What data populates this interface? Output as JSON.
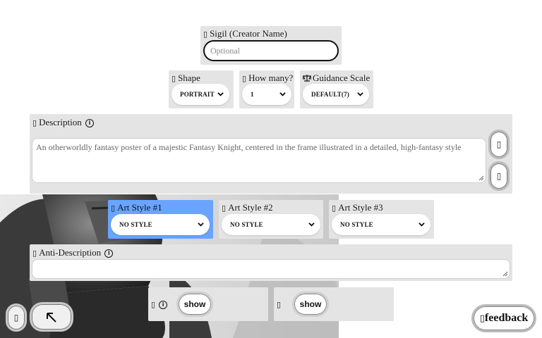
{
  "sigil": {
    "label": "Sigil (Creator Name)",
    "placeholder": "Optional",
    "icon": "glyph-icon"
  },
  "shape": {
    "label": "Shape",
    "value": "PORTRAIT"
  },
  "how_many": {
    "label": "How many?",
    "value": "1"
  },
  "guidance": {
    "label": "Guidance Scale",
    "value": "DEFAULT(7)",
    "icon": "scale-icon"
  },
  "description": {
    "label": "Description",
    "placeholder": "An otherworldly fantasy poster of a majestic Fantasy Knight, centered in the frame illustrated in a detailed, high-fantasy style"
  },
  "art_styles": [
    {
      "label": "Art Style #1",
      "value": "NO STYLE",
      "highlight": "#6aa4ff"
    },
    {
      "label": "Art Style #2",
      "value": "NO STYLE"
    },
    {
      "label": "Art Style #3",
      "value": "NO STYLE"
    }
  ],
  "anti_description": {
    "label": "Anti-Description",
    "placeholder": ""
  },
  "toggles": [
    {
      "show_label": "show"
    },
    {
      "show_label": "show"
    }
  ],
  "feedback": {
    "label": "feedback"
  },
  "glyph": "▯",
  "info_glyph": "i",
  "colors": {
    "panel": "#e4e4e4",
    "accent": "#6aa4ff"
  }
}
